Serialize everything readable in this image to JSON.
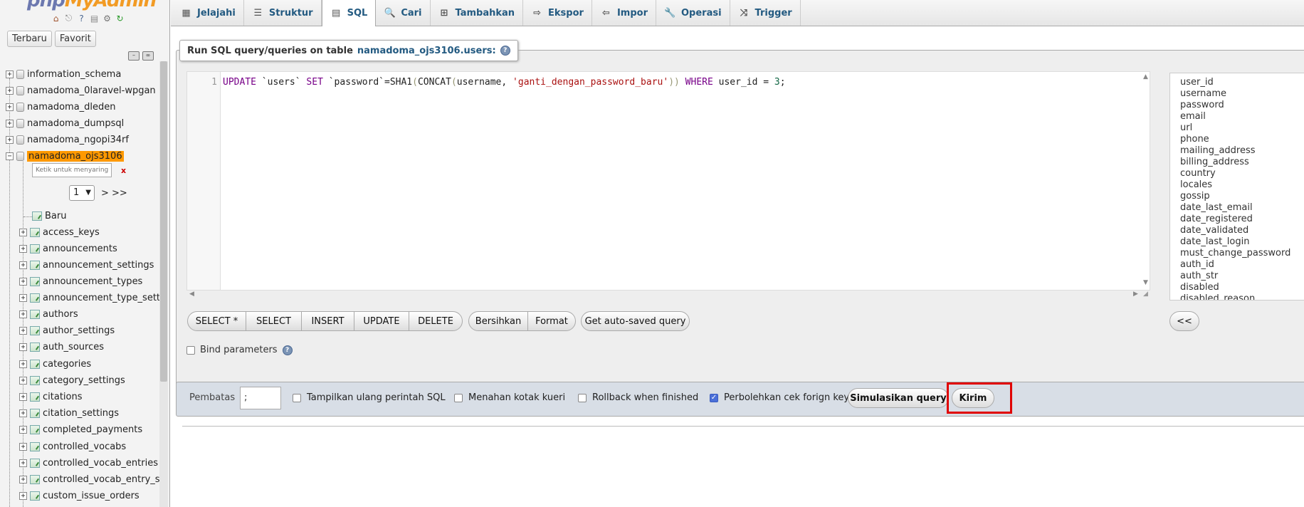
{
  "app": {
    "logo_part1": "php",
    "logo_part2": "MyAdmin",
    "nav_tabs": [
      "Terbaru",
      "Favorit"
    ]
  },
  "sidebar": {
    "databases": [
      "information_schema",
      "namadoma_0laravel-wpgan",
      "namadoma_dleden",
      "namadoma_dumpsql",
      "namadoma_ngopi34rf"
    ],
    "active_database": "namadoma_ojs3106",
    "filter_placeholder": "Ketik untuk menyaring ini, Enter untuk mencari semua",
    "filter_clear": "x",
    "page_value": "1",
    "page_next": "> >>",
    "new_label": "Baru",
    "tables": [
      "access_keys",
      "announcements",
      "announcement_settings",
      "announcement_types",
      "announcement_type_settin",
      "authors",
      "author_settings",
      "auth_sources",
      "categories",
      "category_settings",
      "citations",
      "citation_settings",
      "completed_payments",
      "controlled_vocabs",
      "controlled_vocab_entries",
      "controlled_vocab_entry_se",
      "custom_issue_orders"
    ]
  },
  "tabs": [
    {
      "label": "Jelajahi",
      "icon": "browse-icon"
    },
    {
      "label": "Struktur",
      "icon": "structure-icon"
    },
    {
      "label": "SQL",
      "icon": "sql-icon"
    },
    {
      "label": "Cari",
      "icon": "search-icon"
    },
    {
      "label": "Tambahkan",
      "icon": "insert-icon"
    },
    {
      "label": "Ekspor",
      "icon": "export-icon"
    },
    {
      "label": "Impor",
      "icon": "import-icon"
    },
    {
      "label": "Operasi",
      "icon": "wrench-icon"
    },
    {
      "label": "Trigger",
      "icon": "trigger-icon"
    }
  ],
  "active_tab": "SQL",
  "query": {
    "legend_prefix": "Run SQL query/queries on table",
    "legend_table": "namadoma_ojs3106.users:",
    "line_number": "1",
    "code_tokens": [
      {
        "t": "UPDATE",
        "c": "kw"
      },
      {
        "t": " `users` ",
        "c": "bq"
      },
      {
        "t": "SET",
        "c": "kw"
      },
      {
        "t": " `password`",
        "c": "bq"
      },
      {
        "t": "=",
        "c": "op"
      },
      {
        "t": "SHA1",
        "c": "fn"
      },
      {
        "t": "(",
        "c": "br"
      },
      {
        "t": "CONCAT",
        "c": "fn"
      },
      {
        "t": "(",
        "c": "br"
      },
      {
        "t": "username, ",
        "c": "bq"
      },
      {
        "t": "'ganti_dengan_password_baru'",
        "c": "str"
      },
      {
        "t": "))",
        "c": "br"
      },
      {
        "t": " WHERE ",
        "c": "kw"
      },
      {
        "t": "user_id ",
        "c": "bq"
      },
      {
        "t": "=",
        "c": "op"
      },
      {
        "t": " 3",
        "c": "num"
      },
      {
        "t": ";",
        "c": "op"
      }
    ]
  },
  "columns": [
    "user_id",
    "username",
    "password",
    "email",
    "url",
    "phone",
    "mailing_address",
    "billing_address",
    "country",
    "locales",
    "gossip",
    "date_last_email",
    "date_registered",
    "date_validated",
    "date_last_login",
    "must_change_password",
    "auth_id",
    "auth_str",
    "disabled",
    "disabled_reason"
  ],
  "buttons": {
    "select_all": "SELECT *",
    "select": "SELECT",
    "insert": "INSERT",
    "update": "UPDATE",
    "delete": "DELETE",
    "clear": "Bersihkan",
    "format": "Format",
    "autosaved": "Get auto-saved query",
    "insert_column": "<<"
  },
  "bind_parameters": "Bind parameters",
  "options": {
    "delimiter_label": "Pembatas",
    "delimiter_value": ";",
    "show_query": "Tampilkan ulang perintah SQL",
    "retain_box": "Menahan kotak kueri",
    "rollback": "Rollback when finished",
    "fk_check": "Perbolehkan cek forign key",
    "fk_checked": true,
    "simulate": "Simulasikan query",
    "submit": "Kirim"
  },
  "colors": {
    "accent_link": "#235a81",
    "active_db_bg": "#ff9900",
    "highlight_box": "#e00000"
  }
}
